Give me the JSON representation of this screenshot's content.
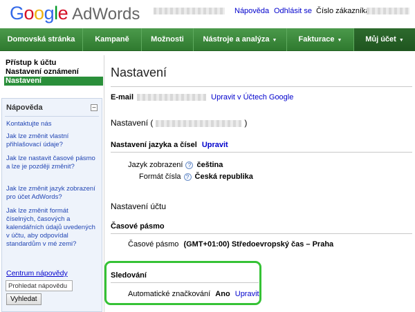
{
  "header": {
    "logo_google": [
      "G",
      "o",
      "o",
      "g",
      "l",
      "e"
    ],
    "logo_product": "AdWords",
    "help_link": "Nápověda",
    "logout_link": "Odhlásit se",
    "customer_label": "Číslo zákazníka:"
  },
  "nav": {
    "items": [
      {
        "label": "Domovská stránka"
      },
      {
        "label": "Kampaně"
      },
      {
        "label": "Možnosti"
      },
      {
        "label": "Nástroje a analýza",
        "dropdown": "▼"
      },
      {
        "label": "Fakturace",
        "dropdown": "▼"
      },
      {
        "label": "Můj účet",
        "dropdown": "▼",
        "active": true
      }
    ]
  },
  "sidenav": {
    "items": [
      {
        "label": "Přístup k účtu"
      },
      {
        "label": "Nastavení oznámení"
      },
      {
        "label": "Nastavení",
        "active": true
      }
    ]
  },
  "help": {
    "title": "Nápověda",
    "collapse_symbol": "–",
    "links": [
      "Kontaktujte nás",
      "Jak lze změnit vlastní přihlašovací údaje?",
      "Jak lze nastavit časové pásmo a lze je později změnit?",
      "Jak lze změnit jazyk zobrazení pro účet AdWords?",
      "Jak lze změnit formát číselných, časových a kalendářních údajů uvedených v účtu, aby odpovídal standardům v mé zemi?"
    ],
    "center_link": "Centrum nápovědy",
    "search_value": "Prohledat nápovědu",
    "search_button": "Vyhledat"
  },
  "main": {
    "title": "Nastavení",
    "email_label": "E-mail",
    "email_edit_link": "Upravit v Účtech Google",
    "settings_prefix": "Nastavení (",
    "settings_suffix": ")",
    "lang_section": "Nastavení jazyka a čísel",
    "lang_edit": "Upravit",
    "display_lang_label": "Jazyk zobrazení",
    "display_lang_value": "čeština",
    "number_format_label": "Formát čísla",
    "number_format_value": "Česká republika",
    "help_icon_glyph": "?",
    "account_settings": "Nastavení účtu",
    "timezone_section": "Časové pásmo",
    "timezone_label": "Časové pásmo",
    "timezone_value": "(GMT+01:00) Středoevropský čas – Praha",
    "tracking_section": "Sledování",
    "autotag_label": "Automatické značkování",
    "autotag_value": "Ano",
    "autotag_edit": "Upravit"
  },
  "colors": {
    "nav_green": "#3a8a3a",
    "active_sidenav": "#2a8f3a",
    "highlight": "#35c235",
    "link_blue": "#0000cc"
  }
}
